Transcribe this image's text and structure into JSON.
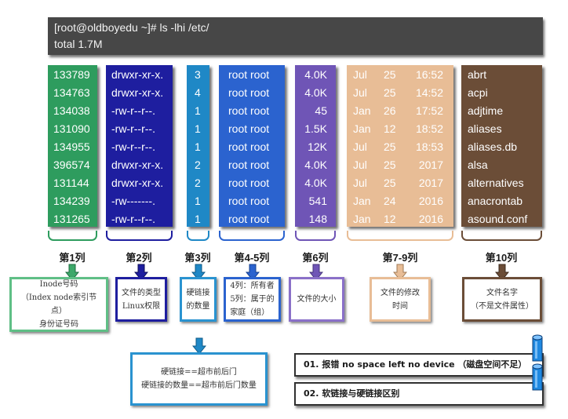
{
  "terminal": {
    "command": "[root@oldboyedu ~]# ls -lhi /etc/",
    "total": "total 1.7M"
  },
  "columns": {
    "inode": [
      "133789",
      "134763",
      "134038",
      "131090",
      "134955",
      "396574",
      "131144",
      "134239",
      "131265"
    ],
    "perms": [
      "drwxr-xr-x.",
      "drwxr-xr-x.",
      "-rw-r--r--.",
      "-rw-r--r--.",
      "-rw-r--r--.",
      "drwxr-xr-x.",
      "drwxr-xr-x.",
      "-rw-------.",
      "-rw-r--r--."
    ],
    "links": [
      "3",
      "4",
      "1",
      "1",
      "1",
      "2",
      "2",
      "1",
      "1"
    ],
    "owner": [
      "root root",
      "root root",
      "root root",
      "root root",
      "root root",
      "root root",
      "root root",
      "root root",
      "root root"
    ],
    "size": [
      "4.0K",
      "4.0K",
      "45",
      "1.5K",
      "12K",
      "4.0K",
      "4.0K",
      "541",
      "148"
    ],
    "month": [
      "Jul",
      "Jul",
      "Jan",
      "Jan",
      "Jul",
      "Jul",
      "Jul",
      "Jan",
      "Jan"
    ],
    "day": [
      "25",
      "25",
      "26",
      "12",
      "25",
      "25",
      "25",
      "24",
      "12"
    ],
    "time": [
      "16:52",
      "14:52",
      "17:52",
      "18:52",
      "18:53",
      "2017",
      "2017",
      "2016",
      "2016"
    ],
    "name": [
      "abrt",
      "acpi",
      "adjtime",
      "aliases",
      "aliases.db",
      "alsa",
      "alternatives",
      "anacrontab",
      "asound.conf"
    ]
  },
  "labels": {
    "col1": "第1列",
    "col2": "第2列",
    "col3": "第3列",
    "col45": "第4-5列",
    "col6": "第6列",
    "col79": "第7-9列",
    "col10": "第10列"
  },
  "notes": {
    "inode": "Inode号码\n（Index node索引节点）\n身份证号码",
    "perms": "文件的类型\nLinux权限",
    "links": "硬链接\n的数量",
    "owner": "4列：所有者\n5列：属于的\n家庭（组）",
    "size": "文件的大小",
    "time": "文件的修改\n时间",
    "name": "文件名字\n（不是文件属性）",
    "hardlink": "硬链接==超市前后门\n硬链接的数量==超市前后门数量"
  },
  "info": {
    "item1": "01. 报错 no space left no device （磁盘空间不足）",
    "item2": "02. 软链接与硬链接区别"
  },
  "colors": {
    "inode": "#2e9c5e",
    "perms": "#1e1e9f",
    "links": "#1f88c6",
    "owner": "#2b63cf",
    "size": "#6f55b6",
    "time": "#e8bd96",
    "name": "#6b4d37",
    "terminal": "#474747"
  }
}
